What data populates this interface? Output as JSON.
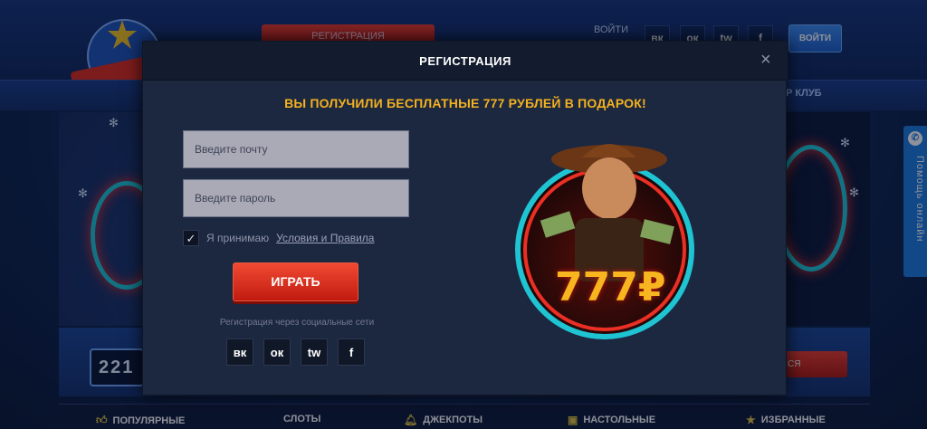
{
  "header": {
    "register_button": "РЕГИСТРАЦИЯ",
    "login_link": "ВОЙТИ",
    "login_button": "ВОЙТИ",
    "social": [
      "вк",
      "ок",
      "tw",
      "f"
    ],
    "club_label": "Р КЛУБ"
  },
  "background": {
    "counter": "221",
    "red_button_fragment": "СЯ",
    "categories": [
      {
        "icon": "thumb-up-icon",
        "label": "ПОПУЛЯРНЫЕ"
      },
      {
        "icon": "none",
        "label": "СЛОТЫ"
      },
      {
        "icon": "bell-icon",
        "label": "ДЖЕКПОТЫ"
      },
      {
        "icon": "phone-icon",
        "label": "НАСТОЛЬНЫЕ"
      },
      {
        "icon": "star-icon",
        "label": "ИЗБРАННЫЕ"
      }
    ],
    "help_tab": "Помощь онлайн"
  },
  "modal": {
    "title": "РЕГИСТРАЦИЯ",
    "close": "×",
    "gift_text": "ВЫ ПОЛУЧИЛИ БЕСПЛАТНЫЕ 777 РУБЛЕЙ В ПОДАРОК!",
    "email_placeholder": "Введите почту",
    "password_placeholder": "Введите пароль",
    "agree_text": "Я принимаю",
    "terms_link": "Условия и Правила",
    "agree_checked": true,
    "play_button": "ИГРАТЬ",
    "social_caption": "Регистрация через социальные сети",
    "social": [
      "вк",
      "ок",
      "tw",
      "f"
    ],
    "promo_amount": "777₽"
  },
  "colors": {
    "accent_gold": "#f3b21f",
    "button_red": "#d1281a",
    "login_blue": "#2e76e0"
  }
}
